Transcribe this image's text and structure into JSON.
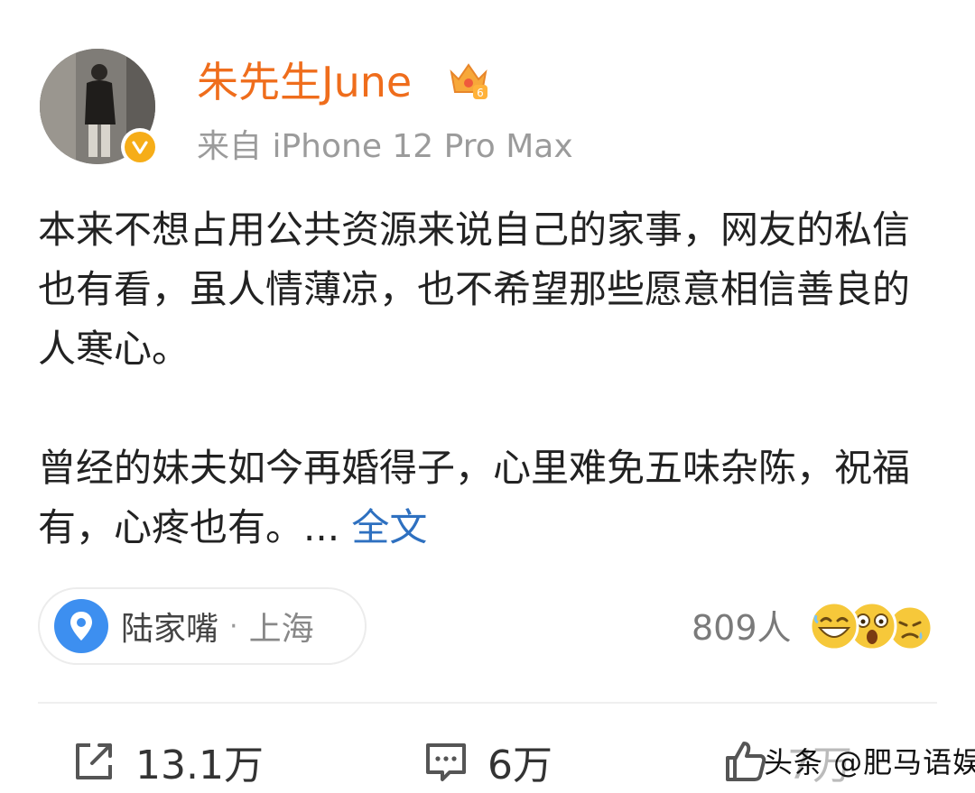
{
  "author": {
    "name": "朱先生June",
    "source": "来自 iPhone 12 Pro Max",
    "verified_icon": "verified-v-icon",
    "badge_icon": "crown-level-icon"
  },
  "post": {
    "paragraph1": "本来不想占用公共资源来说自己的家事，网友的私信也有看，虽人情薄凉，也不希望那些愿意相信善良的人寒心。",
    "paragraph2": "曾经的妹夫如今再婚得子，心里难免五味杂陈，祝福有，心疼也有。...",
    "full_text_link": "全文"
  },
  "location": {
    "name": "陆家嘴",
    "separator": "·",
    "city": "上海"
  },
  "reactions": {
    "count": "809人",
    "emojis": [
      "grin-emoji",
      "shocked-emoji",
      "sad-emoji"
    ]
  },
  "actions": {
    "share_count": "13.1万",
    "comment_count": "6万",
    "like_count": "7万"
  },
  "watermark": "头条 @肥马语娱",
  "colors": {
    "username": "#ef6d1c",
    "link": "#2e70c0",
    "verified": "#f6ad18"
  }
}
